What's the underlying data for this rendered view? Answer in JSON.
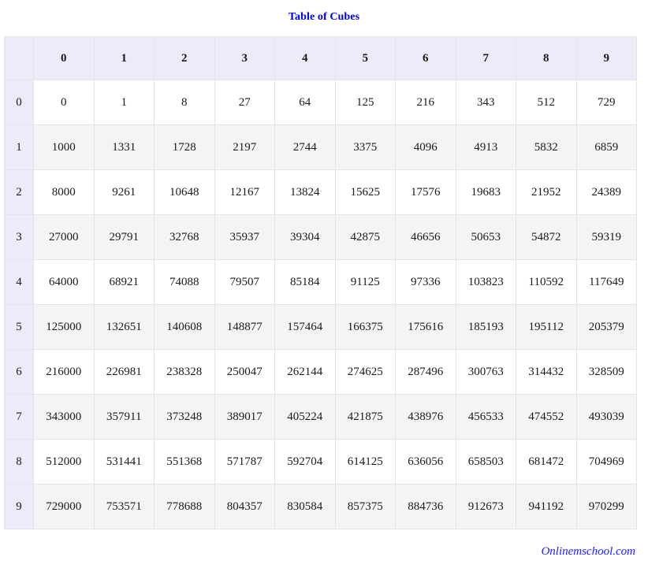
{
  "page": {
    "title": "Table of Cubes",
    "footer": "Onlinemschool.com",
    "title_color": "#0000ee",
    "footer_color": "#2222ee",
    "header_bg": "#ecebfa",
    "stripe_bg": "#f4f4f4",
    "grid_color": "#e4e4e4"
  },
  "chart_data": {
    "type": "table",
    "title": "Table of Cubes",
    "corner_label": "",
    "column_headers": [
      "0",
      "1",
      "2",
      "3",
      "4",
      "5",
      "6",
      "7",
      "8",
      "9"
    ],
    "row_headers": [
      "0",
      "1",
      "2",
      "3",
      "4",
      "5",
      "6",
      "7",
      "8",
      "9"
    ],
    "rows": [
      [
        "0",
        "1",
        "8",
        "27",
        "64",
        "125",
        "216",
        "343",
        "512",
        "729"
      ],
      [
        "1000",
        "1331",
        "1728",
        "2197",
        "2744",
        "3375",
        "4096",
        "4913",
        "5832",
        "6859"
      ],
      [
        "8000",
        "9261",
        "10648",
        "12167",
        "13824",
        "15625",
        "17576",
        "19683",
        "21952",
        "24389"
      ],
      [
        "27000",
        "29791",
        "32768",
        "35937",
        "39304",
        "42875",
        "46656",
        "50653",
        "54872",
        "59319"
      ],
      [
        "64000",
        "68921",
        "74088",
        "79507",
        "85184",
        "91125",
        "97336",
        "103823",
        "110592",
        "117649"
      ],
      [
        "125000",
        "132651",
        "140608",
        "148877",
        "157464",
        "166375",
        "175616",
        "185193",
        "195112",
        "205379"
      ],
      [
        "216000",
        "226981",
        "238328",
        "250047",
        "262144",
        "274625",
        "287496",
        "300763",
        "314432",
        "328509"
      ],
      [
        "343000",
        "357911",
        "373248",
        "389017",
        "405224",
        "421875",
        "438976",
        "456533",
        "474552",
        "493039"
      ],
      [
        "512000",
        "531441",
        "551368",
        "571787",
        "592704",
        "614125",
        "636056",
        "658503",
        "681472",
        "704969"
      ],
      [
        "729000",
        "753571",
        "778688",
        "804357",
        "830584",
        "857375",
        "884736",
        "912673",
        "941192",
        "970299"
      ]
    ]
  }
}
